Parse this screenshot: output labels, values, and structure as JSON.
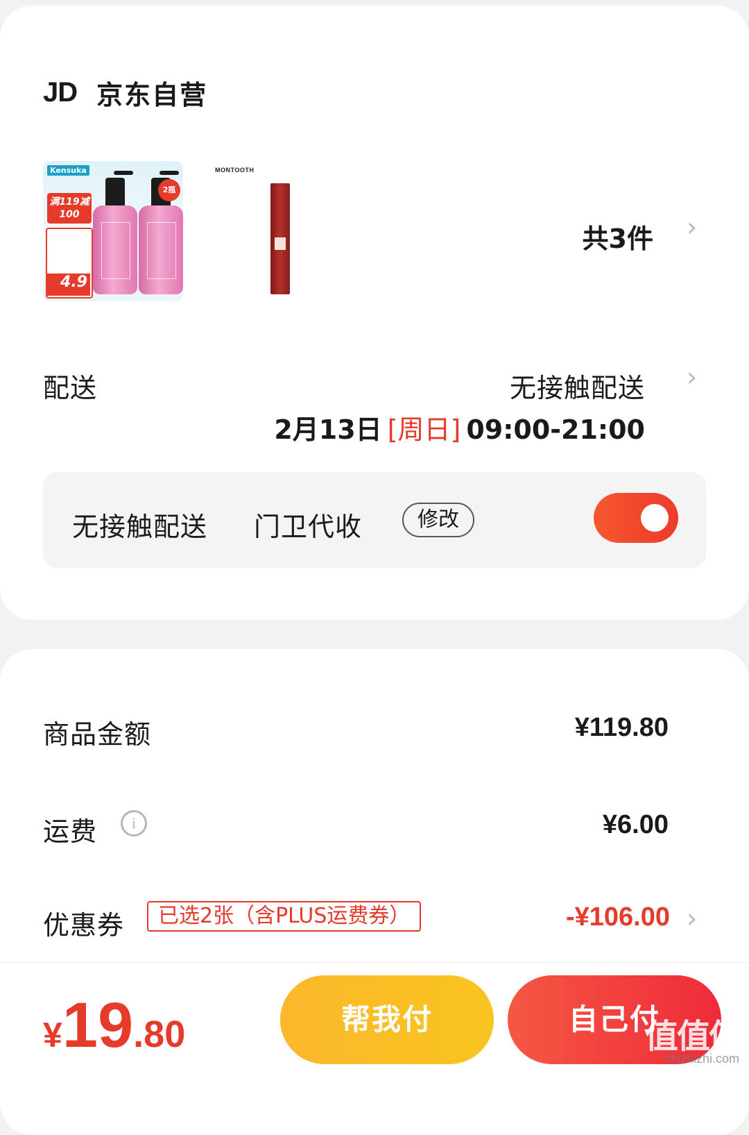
{
  "shop": {
    "logo": "JD",
    "name": "京东自营"
  },
  "products": {
    "item1": {
      "brand": "Kensuka",
      "promo": "满119减100",
      "price": "4.9",
      "badge": "2瓶"
    },
    "item2": {
      "brand": "MONTOOTH"
    },
    "count": "共3件"
  },
  "delivery": {
    "label": "配送",
    "mode": "无接触配送",
    "date": "2月13日",
    "weekday": "[周日]",
    "time": "09:00-21:00",
    "contactless": {
      "label": "无接触配送",
      "option": "门卫代收",
      "modify": "修改",
      "enabled": true
    }
  },
  "summary": {
    "goods": {
      "label": "商品金额",
      "value": "¥119.80"
    },
    "shipping": {
      "label": "运费",
      "value": "¥6.00"
    },
    "coupon": {
      "label": "优惠券",
      "tag": "已选2张（含PLUS运费券）",
      "value": "-¥106.00"
    }
  },
  "footer": {
    "total_currency": "¥",
    "total_int": "19",
    "total_dec": ".80",
    "help_pay": "帮我付",
    "self_pay": "自己付",
    "watermark": "值值值",
    "watermark_url": "zhizhizhi.com"
  },
  "colors": {
    "accent_red": "#e63a2a",
    "help_yellow": "#fbb82c",
    "self_red": "#ef2b3a"
  }
}
